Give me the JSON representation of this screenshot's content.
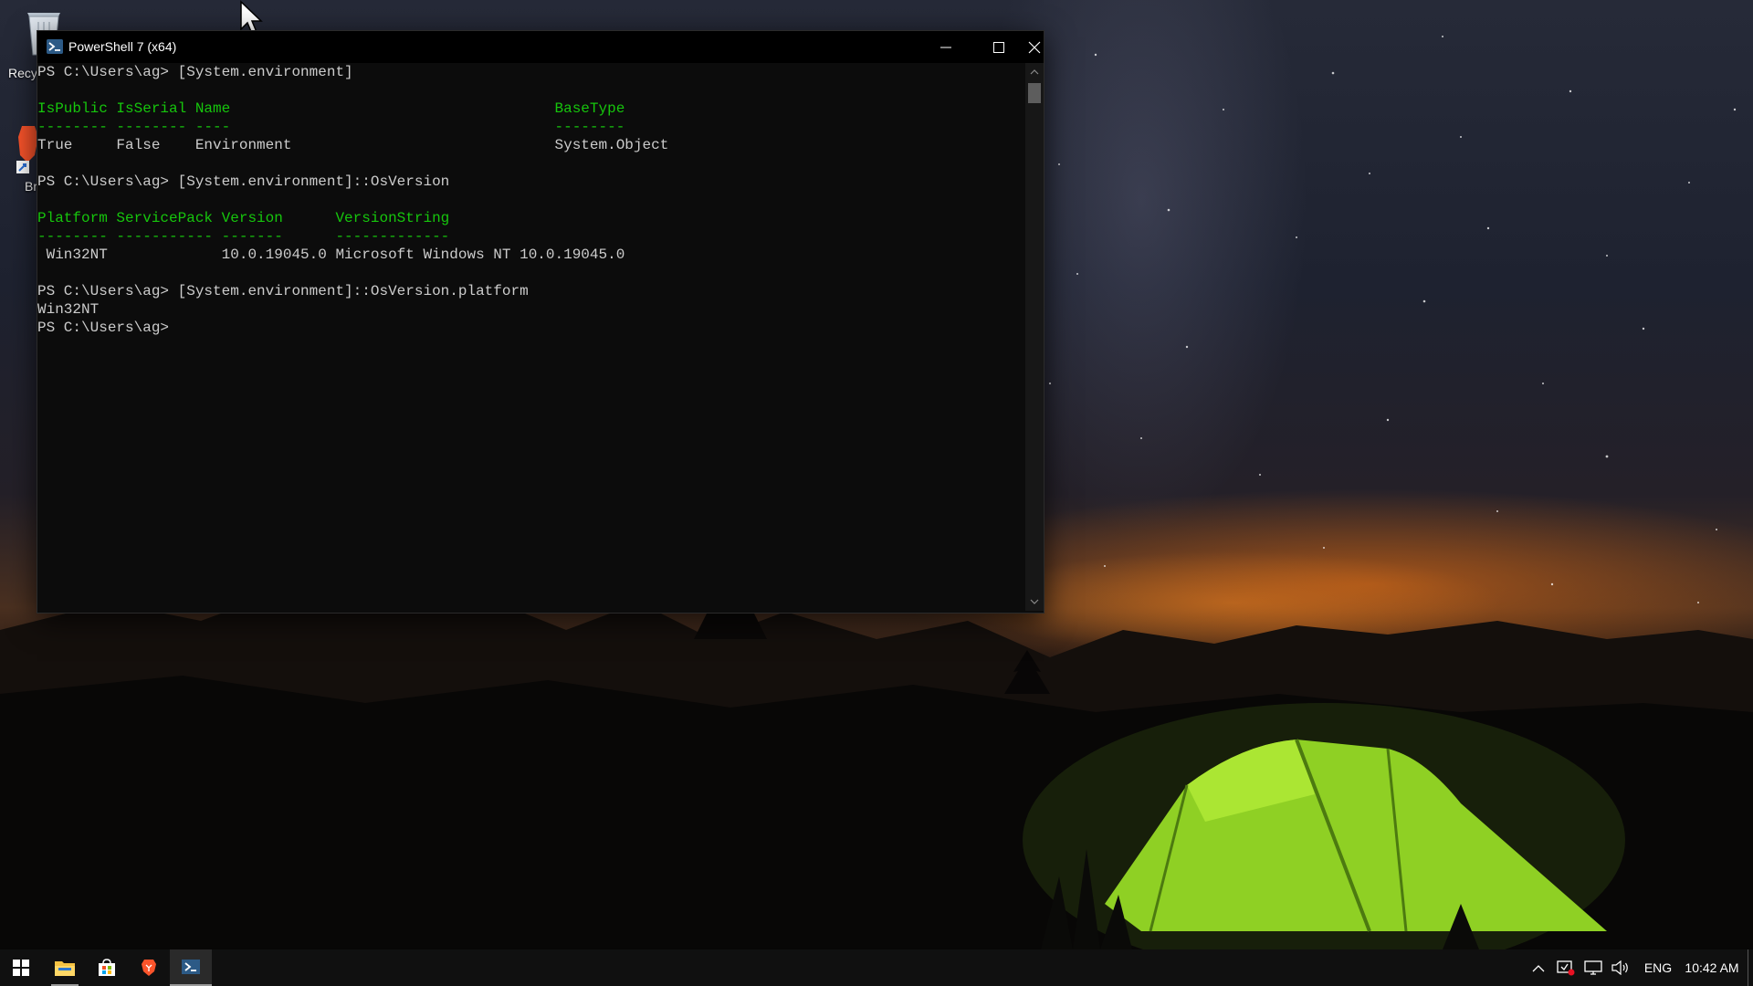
{
  "window": {
    "title": "PowerShell 7 (x64)",
    "controls": {
      "minimize": "minimize-icon",
      "maximize": "maximize-icon",
      "close": "close-icon"
    }
  },
  "desktop": {
    "icons": [
      {
        "label": "Recy",
        "icon": "recycle-bin-icon"
      },
      {
        "label": "Br",
        "icon": "brave-shortcut-icon"
      }
    ]
  },
  "terminal": {
    "lines": [
      {
        "text": "PS C:\\Users\\ag> [System.environment]",
        "color": "#cccccc"
      },
      {
        "text": "",
        "color": "#cccccc"
      },
      {
        "text": "IsPublic IsSerial Name                                     BaseType",
        "color": "#16c60c"
      },
      {
        "text": "-------- -------- ----                                     --------",
        "color": "#16c60c"
      },
      {
        "text": "True     False    Environment                              System.Object",
        "color": "#cccccc"
      },
      {
        "text": "",
        "color": "#cccccc"
      },
      {
        "text": "PS C:\\Users\\ag> [System.environment]::OsVersion",
        "color": "#cccccc"
      },
      {
        "text": "",
        "color": "#cccccc"
      },
      {
        "text": "Platform ServicePack Version      VersionString",
        "color": "#16c60c"
      },
      {
        "text": "-------- ----------- -------      -------------",
        "color": "#16c60c"
      },
      {
        "text": " Win32NT             10.0.19045.0 Microsoft Windows NT 10.0.19045.0",
        "color": "#cccccc"
      },
      {
        "text": "",
        "color": "#cccccc"
      },
      {
        "text": "PS C:\\Users\\ag> [System.environment]::OsVersion.platform",
        "color": "#cccccc"
      },
      {
        "text": "Win32NT",
        "color": "#cccccc"
      },
      {
        "text": "PS C:\\Users\\ag> ",
        "color": "#cccccc"
      }
    ]
  },
  "taskbar": {
    "items": [
      {
        "name": "start-button",
        "icon": "windows-logo-icon"
      },
      {
        "name": "file-explorer-button",
        "icon": "folder-icon"
      },
      {
        "name": "store-button",
        "icon": "store-bag-icon"
      },
      {
        "name": "brave-button",
        "icon": "brave-lion-icon"
      },
      {
        "name": "powershell-button",
        "icon": "powershell-icon",
        "active": true
      }
    ],
    "tray": {
      "language": "ENG",
      "time": "10:42 AM",
      "icons": [
        "chevron-up-icon",
        "security-icon",
        "network-icon",
        "volume-icon"
      ]
    }
  },
  "colors": {
    "terminal_bg": "#0c0c0c",
    "terminal_fg": "#cccccc",
    "header_green": "#16c60c",
    "titlebar_bg": "#000000",
    "taskbar_bg": "#101010"
  }
}
